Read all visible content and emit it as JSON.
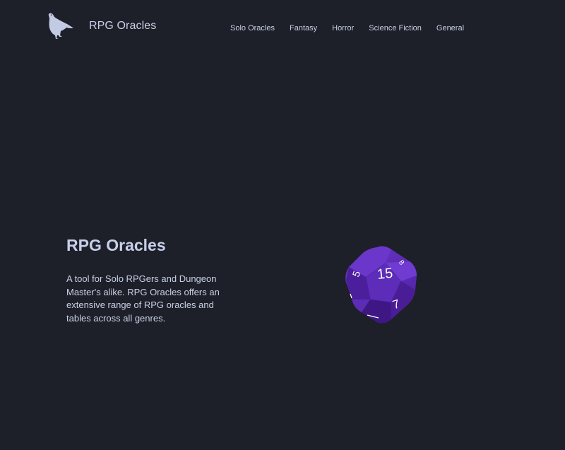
{
  "header": {
    "brand": "RPG Oracles",
    "logo_icon": "raven-icon",
    "nav": [
      {
        "label": "Solo Oracles"
      },
      {
        "label": "Fantasy"
      },
      {
        "label": "Horror"
      },
      {
        "label": "Science Fiction"
      },
      {
        "label": "General"
      }
    ]
  },
  "hero": {
    "title": "RPG Oracles",
    "description": "A tool for Solo RPGers and Dungeon Master's alike. RPG Oracles offers an extensive range of RPG oracles and tables across all genres.",
    "die": {
      "icon": "d20-die-icon",
      "color": "#5b2bb0",
      "faces": [
        "15",
        "5",
        "7",
        "8"
      ]
    }
  },
  "colors": {
    "background": "#1d2029",
    "text": "#c9d0e6",
    "die": "#5b2bb0"
  }
}
